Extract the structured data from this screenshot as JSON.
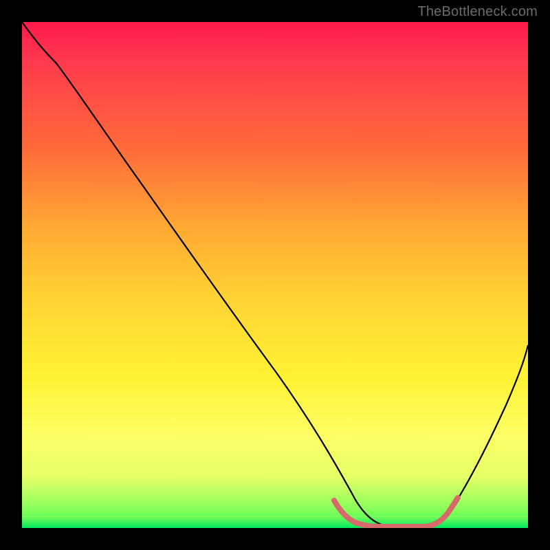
{
  "watermark": "TheBottleneck.com",
  "chart_data": {
    "type": "line",
    "title": "",
    "xlabel": "",
    "ylabel": "",
    "xlim": [
      0,
      100
    ],
    "ylim": [
      0,
      100
    ],
    "x": [
      0,
      3,
      7,
      12,
      20,
      30,
      40,
      50,
      58,
      62,
      65,
      67,
      70,
      73,
      76,
      78,
      80,
      82,
      85,
      88,
      92,
      96,
      100
    ],
    "values": [
      100,
      96,
      92,
      86,
      76,
      63,
      50,
      37,
      25,
      18,
      12,
      8,
      4,
      1.5,
      0.3,
      0,
      0,
      0.3,
      2,
      7,
      15,
      25,
      36
    ],
    "valley_highlight": {
      "x_start": 62,
      "x_end": 80,
      "color": "#d66a6a"
    },
    "background": "vertical red→yellow→green gradient"
  }
}
